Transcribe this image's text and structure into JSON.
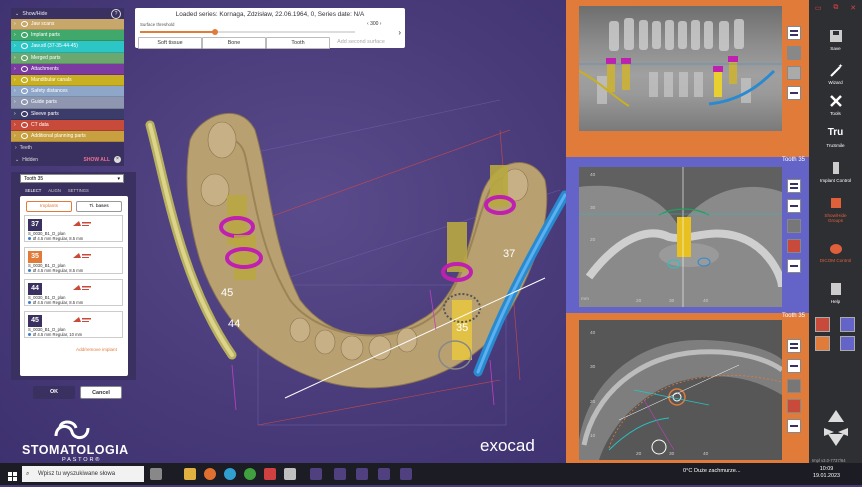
{
  "header": {
    "loaded_series": "Loaded series: Kornaga, Zdzisław, 22.06.1964, 0, Series date: N/A",
    "surface_threshold_label": "Surface threshold",
    "surface_threshold_value": "300",
    "buttons": [
      "Soft tissue",
      "Bone",
      "Tooth",
      "Add second surface"
    ]
  },
  "show_hide": {
    "title": "Show/Hide",
    "help": "?",
    "groups": [
      {
        "label": "Jaw scans",
        "color": "#c8a86a"
      },
      {
        "label": "Implant parts",
        "color": "#3fa86a"
      },
      {
        "label": "Jaw.stl (37-35-44-45)",
        "color": "#2cc6c6"
      },
      {
        "label": "Merged parts",
        "color": "#6aa870"
      },
      {
        "label": "Attachments",
        "color": "#7a3aa0"
      },
      {
        "label": "Mandibular canals",
        "color": "#c8b020"
      },
      {
        "label": "Safety distances",
        "color": "#8ea6c8"
      },
      {
        "label": "Guide parts",
        "color": "#8e96b0"
      },
      {
        "label": "Sleeve parts",
        "color": "#3c3c6a"
      },
      {
        "label": "CT data",
        "color": "#c84a3a"
      },
      {
        "label": "Additional planning parts",
        "color": "#c8a040"
      }
    ],
    "teeth_label": "Teeth",
    "hidden_label": "Hidden",
    "show_all": "SHOW ALL"
  },
  "implant_panel": {
    "tooth_select": "Tooth 35",
    "tabs": [
      "SELECT",
      "ALIGN",
      "SETTINGS"
    ],
    "subtabs": [
      "Implants",
      "Ti. bases"
    ],
    "implants": [
      {
        "num": "37",
        "name": "S_0030_B1_D_plan",
        "spec": "Ø 4.5 mm Regular, 8.5 mm",
        "selected": false
      },
      {
        "num": "35",
        "name": "S_0030_B1_D_plan",
        "spec": "Ø 4.5 mm Regular, 8.5 mm",
        "selected": true
      },
      {
        "num": "44",
        "name": "S_0030_B1_D_plan",
        "spec": "Ø 4.5 mm Regular, 8.5 mm",
        "selected": false
      },
      {
        "num": "45",
        "name": "S_0030_B1_D_plan",
        "spec": "Ø 4.5 mm Regular, 10 mm",
        "selected": false
      }
    ],
    "add_remove": "Add/remove implant",
    "ok": "OK",
    "cancel": "Cancel"
  },
  "viewport": {
    "labels": [
      "37",
      "45",
      "44",
      "35"
    ]
  },
  "views": {
    "tooth_label_1": "Tooth 35",
    "tooth_label_2": "Tooth 35",
    "ticks_v": [
      "40",
      "30",
      "20",
      "10",
      "0"
    ],
    "ticks_h": [
      "10",
      "20",
      "30",
      "40"
    ],
    "unit": "mm"
  },
  "toolbar": {
    "tools": [
      "Save",
      "Wizard",
      "Tools",
      "TruSmile",
      "Implant Control",
      "Show/Hide Groups",
      "DICOM Control",
      "Help"
    ],
    "tru_glyph": "Tru",
    "version": "Impl v3.0-7737/64"
  },
  "brand": {
    "clinic": "STOMATOLOGIA",
    "clinic_sub": "PASTOR®",
    "app": "exocad"
  },
  "taskbar": {
    "search_placeholder": "Wpisz tu wyszukiwane słowa",
    "weather": "0°C  Duże zachmurze...",
    "time": "10:09",
    "date": "19.01.2023"
  }
}
